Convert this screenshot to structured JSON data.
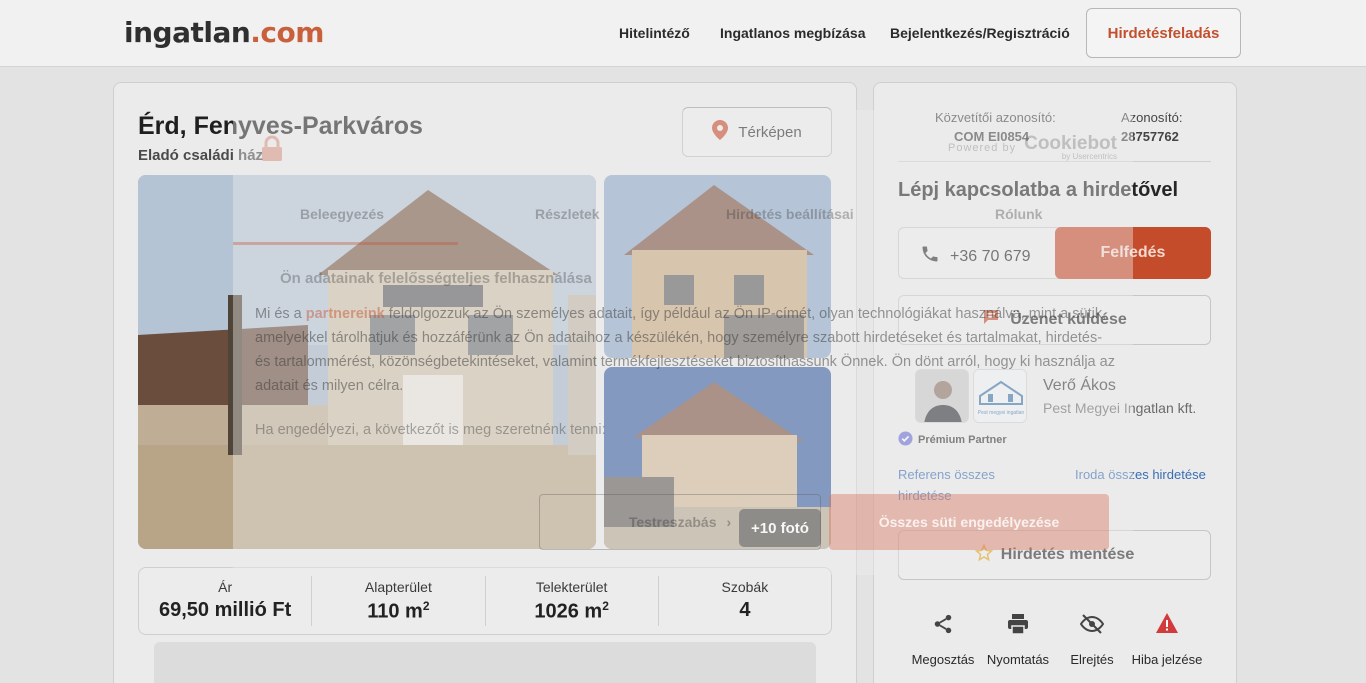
{
  "header": {
    "logo_main": "ingatlan",
    "logo_dot": ".com",
    "nav": [
      "Hitelintéző",
      "Ingatlanos megbízása",
      "Bejelentkezés/Regisztráció"
    ],
    "cta": "Hirdetésfeladás"
  },
  "listing": {
    "title": "Érd, Fenyves-Parkváros",
    "subtitle": "Eladó családi ház",
    "map_button": "Térképen",
    "more_photos": "+10 fotó",
    "stats": [
      {
        "label": "Ár",
        "value": "69,50 millió Ft",
        "unit_sup": ""
      },
      {
        "label": "Alapterület",
        "value": "110 m",
        "unit_sup": "2"
      },
      {
        "label": "Telekterület",
        "value": "1026 m",
        "unit_sup": "2"
      },
      {
        "label": "Szobák",
        "value": "4",
        "unit_sup": ""
      }
    ]
  },
  "sidebar": {
    "broker_id_label": "Közvetítői azonosító:",
    "broker_id": "COM EI0854",
    "id_label": "Azonosító:",
    "id": "28757762",
    "contact_title": "Lépj kapcsolatba a hirdetővel",
    "phone": "+36 70 679",
    "reveal_button": "Felfedés",
    "message_button": "Üzenet küldése",
    "agent_name": "Verő Ákos",
    "agent_office": "Pest Megyei Ingatlan kft.",
    "office_logo_text": "Pest megyei ingatlan",
    "premium_label": "Prémium Partner",
    "link_referent": "Referens összes hirdetése",
    "link_office": "Iroda összes hirdetése",
    "save_button": "Hirdetés mentése",
    "actions": [
      "Megosztás",
      "Nyomtatás",
      "Elrejtés",
      "Hiba jelzése"
    ]
  },
  "cookie": {
    "powered_by": "Powered by",
    "cookiebot": "Cookiebot",
    "cookiebot_sub": "by Usercentrics",
    "tabs": [
      "Beleegyezés",
      "Részletek",
      "Hirdetés beállításai",
      "Rólunk"
    ],
    "heading": "Ön adatainak felelősségteljes felhasználása",
    "body_pre": "Mi és a ",
    "body_link": "partnereink",
    "body_post": " feldolgozzuk az Ön személyes adatait, így például az Ön IP-címét, olyan technológiákat használva, mint a sütik, amelyekkel tárolhatjuk és hozzáférünk az Ön adataihoz a készülékén, hogy személyre szabott hirdetéseket és tartalmakat, hirdetés- és tartalommérést, közönségbetekintéseket, valamint termékfejlesztéseket biztosíthassunk Önnek. Ön dönt arról, hogy ki használja az adatait és milyen célra.",
    "second_line": "Ha engedélyezi, a következőt is meg szeretnénk tenni:",
    "customize_button": "Testreszabás",
    "accept_button": "Összes süti engedélyezése"
  },
  "colors": {
    "accent": "#c44c2b",
    "link": "#3a6db5",
    "premium": "#6b6fd0",
    "alert": "#d23b3b"
  }
}
